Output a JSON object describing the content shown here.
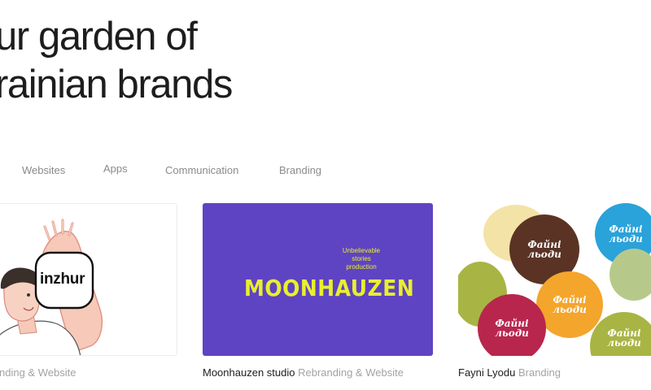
{
  "hero": {
    "line1": "ur garden of",
    "line2": "rainian brands"
  },
  "tabs": [
    {
      "label": "Websites"
    },
    {
      "label": "Apps"
    },
    {
      "label": "Communication"
    },
    {
      "label": "Branding"
    }
  ],
  "cards": [
    {
      "logo_text": "inzhur",
      "name": "",
      "category": "nding & Website"
    },
    {
      "logo_text": "MOONHAUZEN",
      "tagline": "Unbelievable stories production",
      "name": "Moonhauzen studio",
      "category": "Rebranding & Website"
    },
    {
      "ball_text": "Файні льоди",
      "name": "Fayni Lyodu",
      "category": "Branding"
    }
  ],
  "colors": {
    "moonhauzen_bg": "#5e44c2",
    "moonhauzen_accent": "#e9ef2e",
    "tab_text": "#8a8a8a",
    "category_text": "#a3a3a3"
  }
}
